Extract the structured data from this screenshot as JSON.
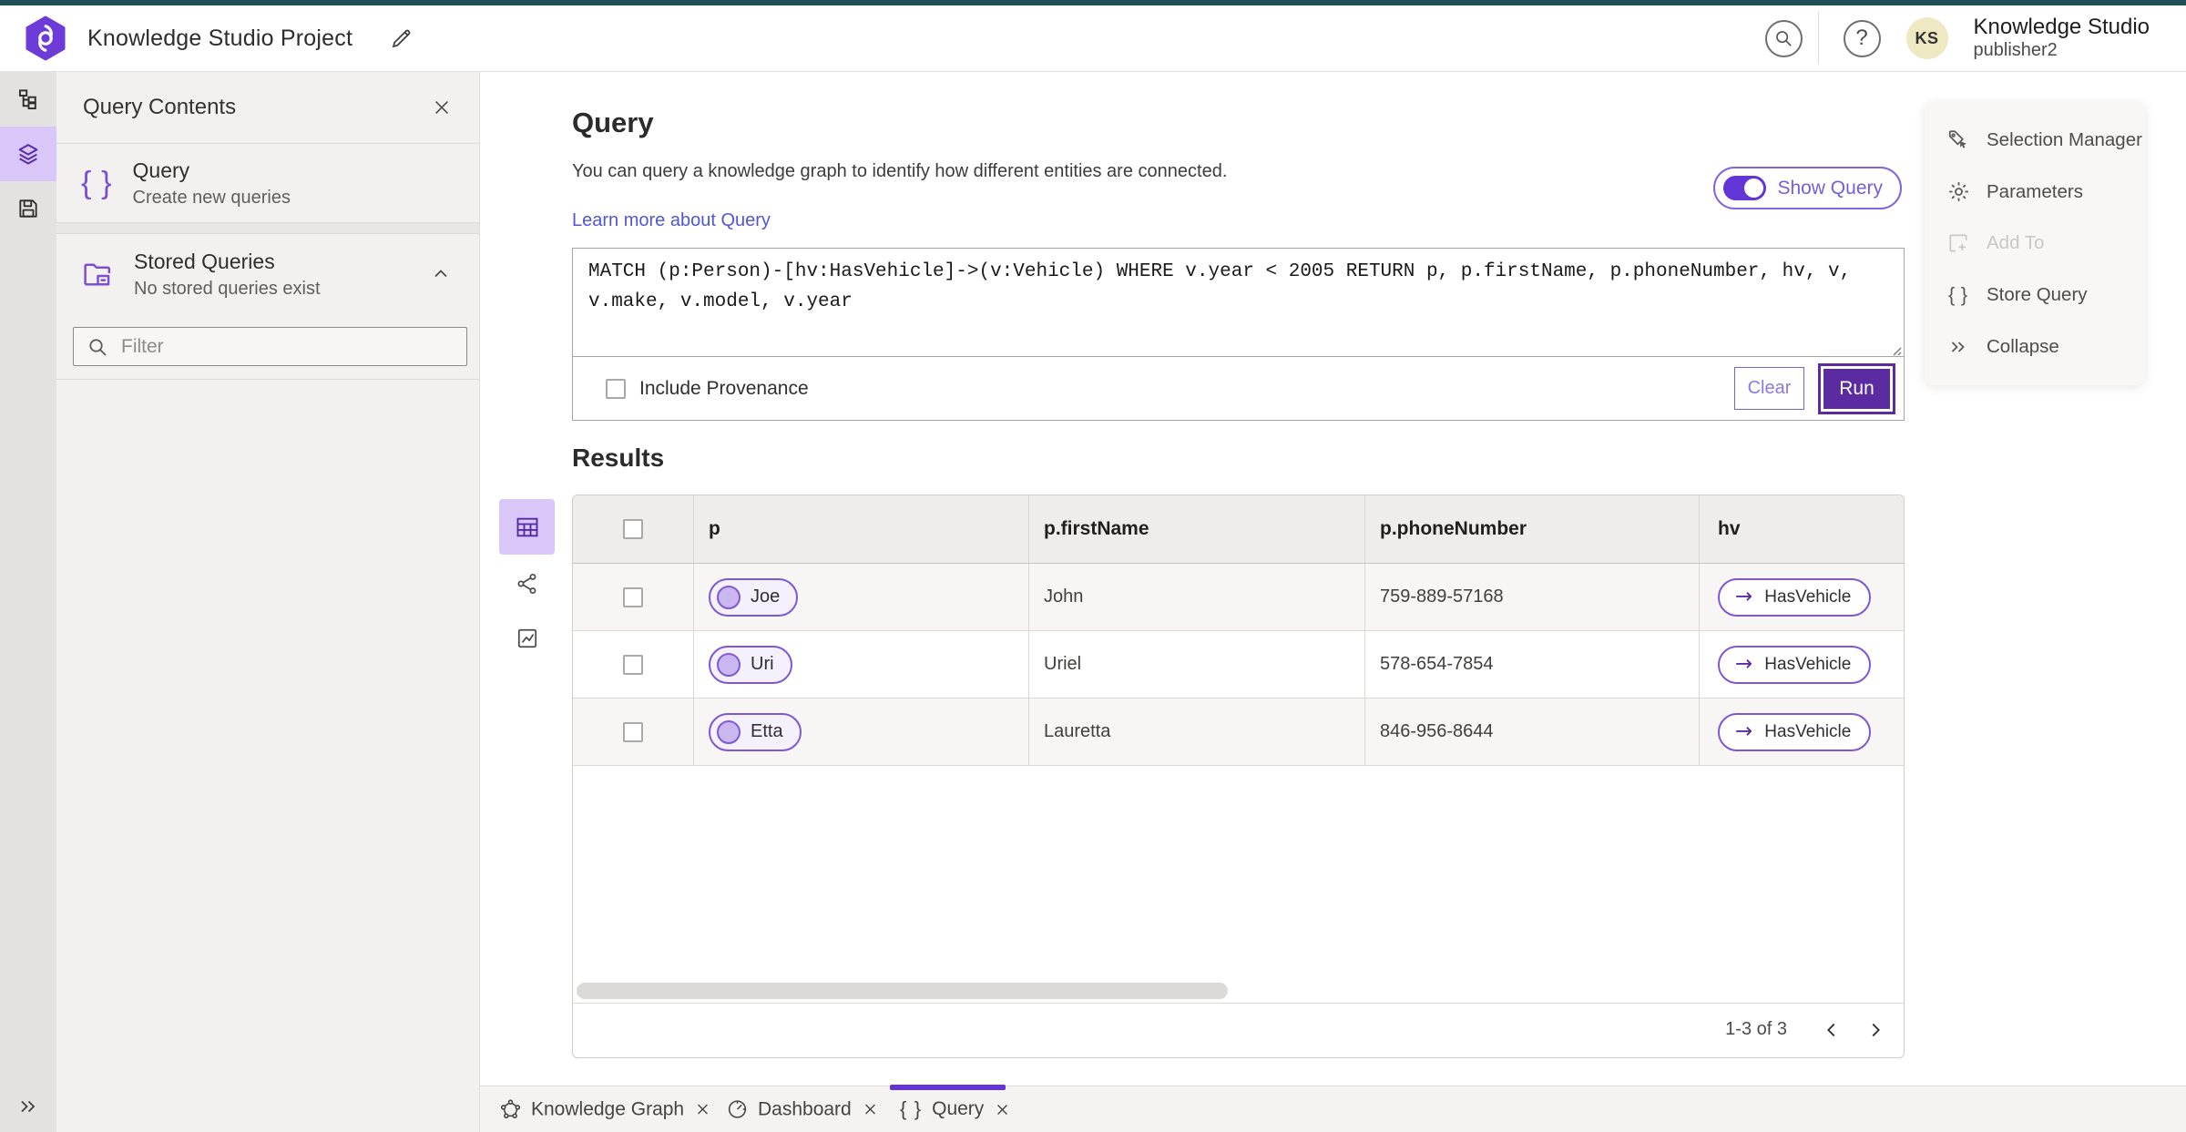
{
  "colors": {
    "accent": "#6a43d8",
    "accent_dark": "#5b2ca1",
    "link": "#5156d6",
    "top_strip": "#1d4e53"
  },
  "topbar": {
    "project_title": "Knowledge Studio Project",
    "product_name": "Knowledge Studio",
    "username": "publisher2",
    "avatar_initials": "KS"
  },
  "sidebar_panel": {
    "title": "Query Contents",
    "query_item": {
      "title": "Query",
      "subtitle": "Create new queries"
    },
    "stored_item": {
      "title": "Stored Queries",
      "subtitle": "No stored queries exist"
    },
    "filter_placeholder": "Filter"
  },
  "query": {
    "heading": "Query",
    "description": "You can query a knowledge graph to identify how different entities are connected.",
    "learn_more": "Learn more about Query",
    "show_query_label": "Show Query",
    "text": "MATCH (p:Person)-[hv:HasVehicle]->(v:Vehicle) WHERE v.year < 2005 RETURN p, p.firstName, p.phoneNumber, hv, v, v.make, v.model, v.year",
    "include_provenance_label": "Include Provenance",
    "clear_label": "Clear",
    "run_label": "Run"
  },
  "results": {
    "heading": "Results",
    "columns": [
      "p",
      "p.firstName",
      "p.phoneNumber",
      "hv"
    ],
    "rows": [
      {
        "p": "Joe",
        "firstName": "John",
        "phoneNumber": "759-889-57168",
        "hv": "HasVehicle"
      },
      {
        "p": "Uri",
        "firstName": "Uriel",
        "phoneNumber": "578-654-7854",
        "hv": "HasVehicle"
      },
      {
        "p": "Etta",
        "firstName": "Lauretta",
        "phoneNumber": "846-956-8644",
        "hv": "HasVehicle"
      }
    ],
    "pagination": "1-3 of 3"
  },
  "context_menu": {
    "items": [
      "Selection Manager",
      "Parameters",
      "Add To",
      "Store Query",
      "Collapse"
    ]
  },
  "tabs": [
    {
      "label": "Knowledge Graph"
    },
    {
      "label": "Dashboard"
    },
    {
      "label": "Query"
    }
  ]
}
